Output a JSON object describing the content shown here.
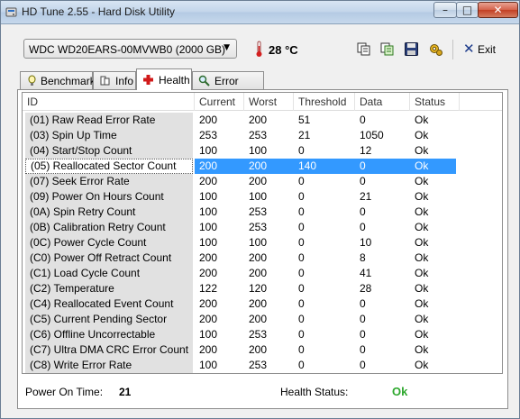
{
  "window": {
    "title": "HD Tune 2.55 - Hard Disk Utility",
    "minimize_glyph": "–",
    "maximize_glyph": "□",
    "close_glyph": "✕"
  },
  "toolbar": {
    "drive": "WDC WD20EARS-00MVWB0 (2000 GB)",
    "dropdown_icon": "dropdown-arrow-icon",
    "temperature": "28 °C",
    "icons": [
      "copy-icon",
      "copy-all-icon",
      "save-icon",
      "options-icon"
    ],
    "exit_label": "Exit"
  },
  "tabs": [
    {
      "label": "Benchmark",
      "icon": "benchmark-icon",
      "active": false
    },
    {
      "label": "Info",
      "icon": "info-icon",
      "active": false
    },
    {
      "label": "Health",
      "icon": "health-icon",
      "active": true
    },
    {
      "label": "Error Scan",
      "icon": "error-scan-icon",
      "active": false
    }
  ],
  "table": {
    "columns": [
      "ID",
      "Current",
      "Worst",
      "Threshold",
      "Data",
      "Status"
    ],
    "selected_row": 3,
    "rows": [
      {
        "id": "(01) Raw Read Error Rate",
        "current": "200",
        "worst": "200",
        "threshold": "51",
        "data": "0",
        "status": "Ok"
      },
      {
        "id": "(03) Spin Up Time",
        "current": "253",
        "worst": "253",
        "threshold": "21",
        "data": "1050",
        "status": "Ok"
      },
      {
        "id": "(04) Start/Stop Count",
        "current": "100",
        "worst": "100",
        "threshold": "0",
        "data": "12",
        "status": "Ok"
      },
      {
        "id": "(05) Reallocated Sector Count",
        "current": "200",
        "worst": "200",
        "threshold": "140",
        "data": "0",
        "status": "Ok"
      },
      {
        "id": "(07) Seek Error Rate",
        "current": "200",
        "worst": "200",
        "threshold": "0",
        "data": "0",
        "status": "Ok"
      },
      {
        "id": "(09) Power On Hours Count",
        "current": "100",
        "worst": "100",
        "threshold": "0",
        "data": "21",
        "status": "Ok"
      },
      {
        "id": "(0A) Spin Retry Count",
        "current": "100",
        "worst": "253",
        "threshold": "0",
        "data": "0",
        "status": "Ok"
      },
      {
        "id": "(0B) Calibration Retry Count",
        "current": "100",
        "worst": "253",
        "threshold": "0",
        "data": "0",
        "status": "Ok"
      },
      {
        "id": "(0C) Power Cycle Count",
        "current": "100",
        "worst": "100",
        "threshold": "0",
        "data": "10",
        "status": "Ok"
      },
      {
        "id": "(C0) Power Off Retract Count",
        "current": "200",
        "worst": "200",
        "threshold": "0",
        "data": "8",
        "status": "Ok"
      },
      {
        "id": "(C1) Load Cycle Count",
        "current": "200",
        "worst": "200",
        "threshold": "0",
        "data": "41",
        "status": "Ok"
      },
      {
        "id": "(C2) Temperature",
        "current": "122",
        "worst": "120",
        "threshold": "0",
        "data": "28",
        "status": "Ok"
      },
      {
        "id": "(C4) Reallocated Event Count",
        "current": "200",
        "worst": "200",
        "threshold": "0",
        "data": "0",
        "status": "Ok"
      },
      {
        "id": "(C5) Current Pending Sector",
        "current": "200",
        "worst": "200",
        "threshold": "0",
        "data": "0",
        "status": "Ok"
      },
      {
        "id": "(C6) Offline Uncorrectable",
        "current": "100",
        "worst": "253",
        "threshold": "0",
        "data": "0",
        "status": "Ok"
      },
      {
        "id": "(C7) Ultra DMA CRC Error Count",
        "current": "200",
        "worst": "200",
        "threshold": "0",
        "data": "0",
        "status": "Ok"
      },
      {
        "id": "(C8) Write Error Rate",
        "current": "100",
        "worst": "253",
        "threshold": "0",
        "data": "0",
        "status": "Ok"
      }
    ]
  },
  "footer": {
    "power_on_label": "Power On Time:",
    "power_on_value": "21",
    "health_label": "Health Status:",
    "health_value": "Ok"
  },
  "colors": {
    "selection": "#3399ff",
    "ok_status": "#2ea82e",
    "id_column_bg": "#e1e1e1"
  }
}
